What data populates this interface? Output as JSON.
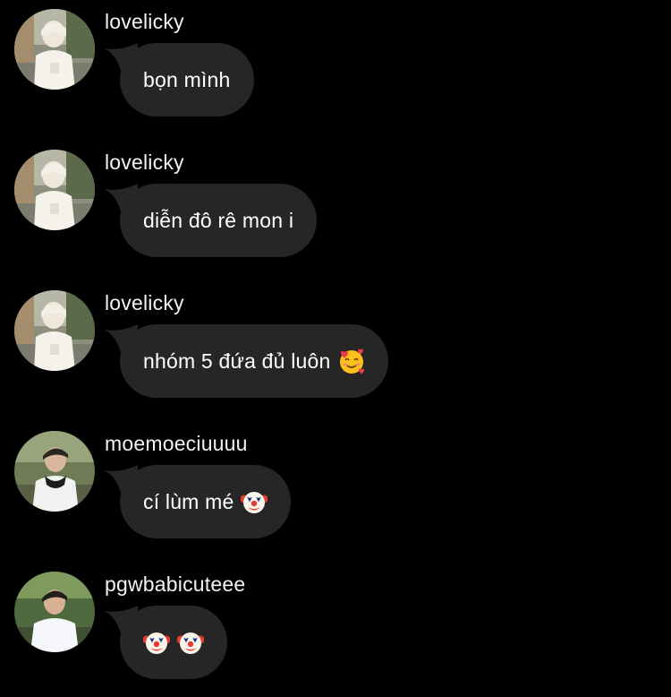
{
  "messages": [
    {
      "username": "lovelicky",
      "text": "bọn mình",
      "emojis": []
    },
    {
      "username": "lovelicky",
      "text": "diễn đô rê mon i",
      "emojis": []
    },
    {
      "username": "lovelicky",
      "text": "nhóm 5 đứa đủ luôn",
      "emojis": [
        "smiling-face-with-hearts-icon"
      ]
    },
    {
      "username": "moemoeciuuuu",
      "text": "cí lùm mé",
      "emojis": [
        "clown-face-icon"
      ]
    },
    {
      "username": "pgwbabicuteee",
      "text": "",
      "emojis": [
        "clown-face-icon",
        "clown-face-icon"
      ]
    }
  ],
  "colors": {
    "background": "#000000",
    "bubble": "#262626",
    "text": "#ffffff"
  }
}
